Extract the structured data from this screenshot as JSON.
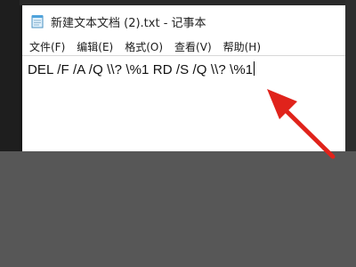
{
  "window": {
    "title": "新建文本文档 (2).txt - 记事本",
    "icon": "notepad-icon"
  },
  "menu": {
    "items": [
      {
        "label": "文件(F)",
        "name": "menu-file"
      },
      {
        "label": "编辑(E)",
        "name": "menu-edit"
      },
      {
        "label": "格式(O)",
        "name": "menu-format"
      },
      {
        "label": "查看(V)",
        "name": "menu-view"
      },
      {
        "label": "帮助(H)",
        "name": "menu-help"
      }
    ]
  },
  "editor": {
    "content": "DEL /F /A /Q \\\\? \\%1 RD /S /Q \\\\? \\%1"
  },
  "annotation": {
    "icon": "red-arrow-icon",
    "color": "#e0231b"
  },
  "colors": {
    "background": "#575757",
    "window": "#ffffff"
  }
}
